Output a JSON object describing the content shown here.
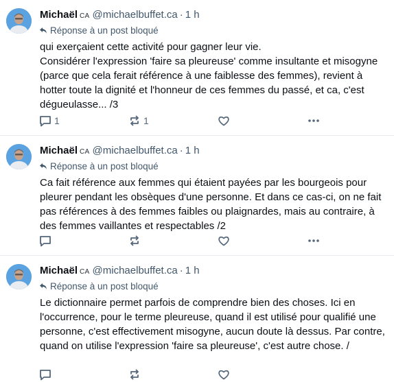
{
  "posts": [
    {
      "author": "Michaël",
      "badge": "CA",
      "handle": "@michaelbuffet.ca",
      "separator": "·",
      "time": "1 h",
      "reply_label": "Réponse à un post bloqué",
      "text": "qui exerçaient cette activité pour gagner leur vie.\nConsidérer l'expression 'faire sa pleureuse' comme insultante et misogyne (parce que cela ferait référence à une faiblesse des femmes), revient à hotter toute la dignité et l'honneur de ces femmes du passé, et ca, c'est dégueulasse... /3",
      "reply_count": "1",
      "repost_count": "1",
      "reply_icon": "speech-bubble-icon",
      "repost_icon": "repost-arrows-icon",
      "like_icon": "heart-icon",
      "more_icon": "ellipsis-icon"
    },
    {
      "author": "Michaël",
      "badge": "CA",
      "handle": "@michaelbuffet.ca",
      "separator": "·",
      "time": "1 h",
      "reply_label": "Réponse à un post bloqué",
      "text": "Ca fait référence aux femmes qui étaient payées par les bourgeois pour pleurer pendant les obsèques d'une personne. Et dans ce cas-ci, on ne fait pas références à des femmes faibles ou plaignardes, mais au contraire, à des femmes vaillantes et respectables /2",
      "reply_count": "",
      "repost_count": "",
      "reply_icon": "speech-bubble-icon",
      "repost_icon": "repost-arrows-icon",
      "like_icon": "heart-icon",
      "more_icon": "ellipsis-icon"
    },
    {
      "author": "Michaël",
      "badge": "CA",
      "handle": "@michaelbuffet.ca",
      "separator": "·",
      "time": "1 h",
      "reply_label": "Réponse à un post bloqué",
      "text": "Le dictionnaire permet parfois de comprendre bien des choses. Ici en l'occurrence, pour le terme pleureuse, quand il est utilisé pour qualifié une personne, c'est effectivement misogyne, aucun doute là dessus. Par contre, quand on utilise l'expression 'faire sa pleureuse', c'est autre chose. /",
      "reply_count": "",
      "repost_count": "",
      "reply_icon": "speech-bubble-icon",
      "repost_icon": "repost-arrows-icon",
      "like_icon": "heart-icon",
      "more_icon": "ellipsis-icon"
    }
  ],
  "colors": {
    "text": "#0b0f14",
    "muted": "#42576b",
    "icon": "#54667a",
    "divider": "#e7eaee",
    "avatar_bg": "#5aa2e0"
  }
}
